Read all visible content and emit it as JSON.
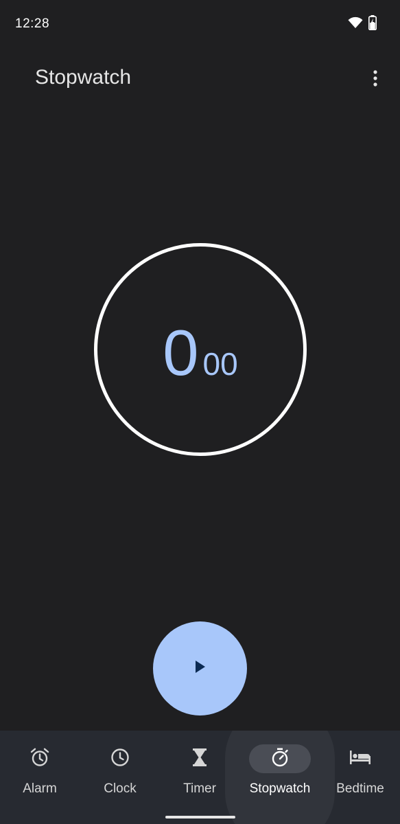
{
  "status_bar": {
    "time": "12:28",
    "icons": [
      "wifi-icon",
      "battery-charging-icon"
    ]
  },
  "app_bar": {
    "title": "Stopwatch",
    "menu_icon": "more-vert-icon"
  },
  "stopwatch": {
    "seconds": "0",
    "hundredths": "00"
  },
  "fab": {
    "icon": "play-icon"
  },
  "bottom_nav": {
    "selected": "Stopwatch",
    "items": [
      {
        "label": "Alarm",
        "icon": "alarm-icon"
      },
      {
        "label": "Clock",
        "icon": "clock-icon"
      },
      {
        "label": "Timer",
        "icon": "hourglass-icon"
      },
      {
        "label": "Stopwatch",
        "icon": "stopwatch-icon"
      },
      {
        "label": "Bedtime",
        "icon": "bed-icon"
      }
    ]
  },
  "colors": {
    "background": "#1f1f21",
    "accent": "#a8c7fa",
    "nav_background": "#272a31",
    "nav_active_pill": "#4a4d55"
  }
}
